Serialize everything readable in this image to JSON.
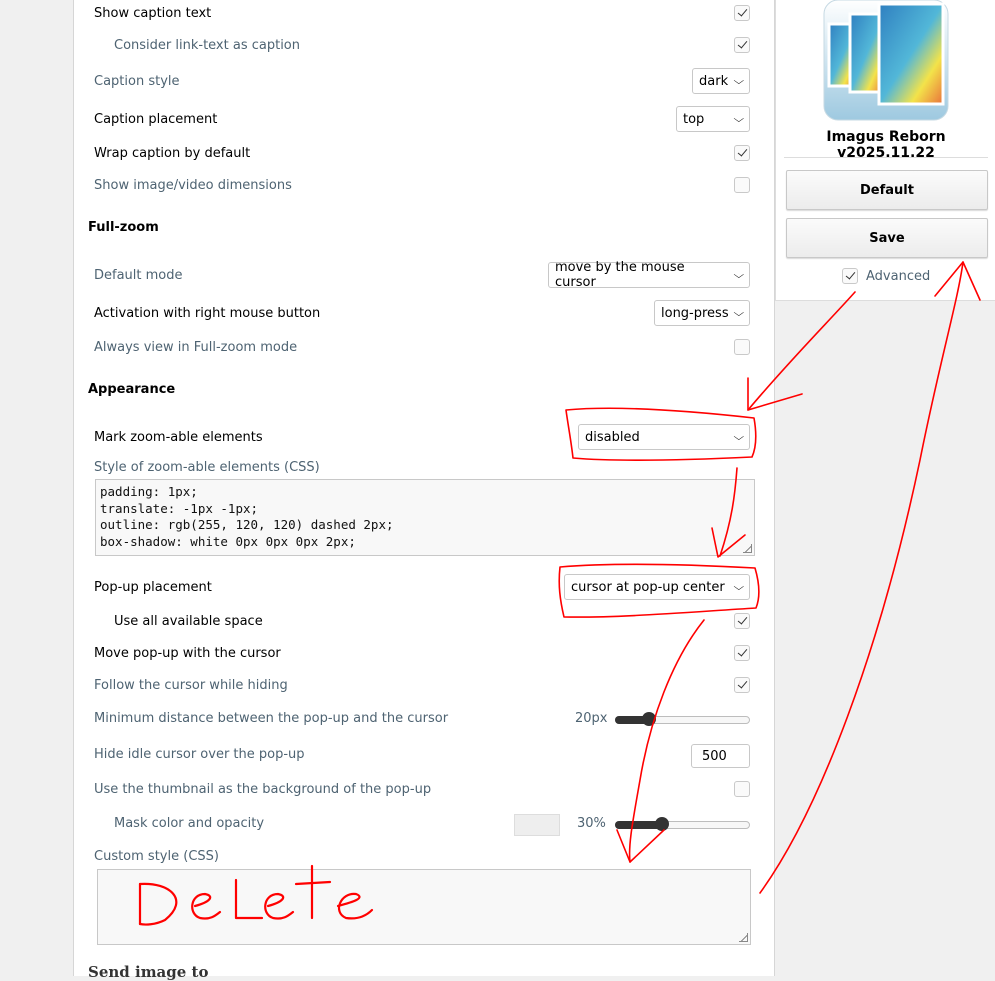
{
  "settings": {
    "show_caption_text": {
      "label": "Show caption text",
      "checked": true
    },
    "link_text_caption": {
      "label": "Consider link-text as caption",
      "checked": true
    },
    "caption_style": {
      "label": "Caption style",
      "value": "dark"
    },
    "caption_placement": {
      "label": "Caption placement",
      "value": "top"
    },
    "wrap_caption": {
      "label": "Wrap caption by default",
      "checked": true
    },
    "show_dimensions": {
      "label": "Show image/video dimensions",
      "checked": false
    },
    "fullzoom_header": "Full-zoom",
    "default_mode": {
      "label": "Default mode",
      "value": "move by the mouse cursor"
    },
    "activation_rmb": {
      "label": "Activation with right mouse button",
      "value": "long-press"
    },
    "always_fullzoom": {
      "label": "Always view in Full-zoom mode",
      "checked": false
    },
    "appearance_header": "Appearance",
    "mark_zoomable": {
      "label": "Mark zoom-able elements",
      "value": "disabled"
    },
    "zoomable_css": {
      "label": "Style of zoom-able elements (CSS)",
      "lines": [
        "padding: 1px;",
        "translate: -1px -1px;",
        "outline: rgb(255, 120, 120) dashed 2px;",
        "box-shadow: white 0px 0px 0px 2px;"
      ]
    },
    "popup_placement": {
      "label": "Pop-up placement",
      "value": "cursor at pop-up center"
    },
    "use_all_space": {
      "label": "Use all available space",
      "checked": true
    },
    "move_popup": {
      "label": "Move pop-up with the cursor",
      "checked": true
    },
    "follow_cursor": {
      "label": "Follow the cursor while hiding",
      "checked": true
    },
    "min_distance": {
      "label": "Minimum distance between the pop-up and the cursor",
      "value_text": "20px",
      "fraction": 0.25
    },
    "hide_idle": {
      "label": "Hide idle cursor over the pop-up",
      "value": "500"
    },
    "thumb_background": {
      "label": "Use the thumbnail as the background of the pop-up",
      "checked": false
    },
    "mask_color": {
      "label": "Mask color and opacity",
      "value_text": "30%",
      "fraction": 0.35,
      "swatch": "#eeeeee"
    },
    "custom_css": {
      "label": "Custom style (CSS)",
      "value": ""
    },
    "send_header": "Send image to"
  },
  "sidebar": {
    "version": "Imagus Reborn v2025.11.22",
    "default_button": "Default",
    "save_button": "Save",
    "advanced": {
      "label": "Advanced",
      "checked": true
    }
  },
  "annotations": {
    "handwritten_text": "DeLete",
    "ink_color": "#ff0000"
  }
}
